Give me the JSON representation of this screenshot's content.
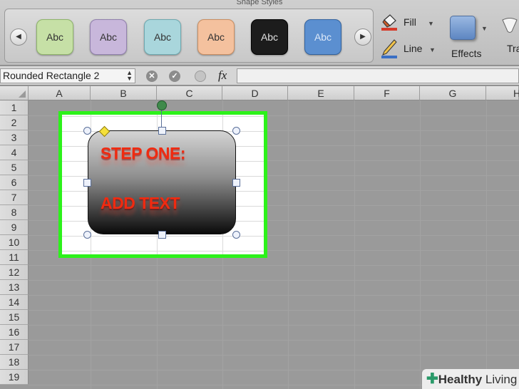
{
  "ribbon": {
    "group_title": "Shape Styles",
    "styles": [
      {
        "label": "Abc",
        "fill": "#c6e0a6",
        "border": "#8fb56a"
      },
      {
        "label": "Abc",
        "fill": "#c8b7db",
        "border": "#9180ad"
      },
      {
        "label": "Abc",
        "fill": "#a9d6dc",
        "border": "#6ea9b0"
      },
      {
        "label": "Abc",
        "fill": "#f4c19e",
        "border": "#c98e62"
      },
      {
        "label": "Abc",
        "fill": "#1c1c1c",
        "border": "#000000",
        "text_color": "#e0e0e0"
      },
      {
        "label": "Abc",
        "fill": "#5b8fd0",
        "border": "#33639f",
        "text_color": "#dce8f8"
      }
    ],
    "fill_label": "Fill",
    "line_label": "Line",
    "effects_label": "Effects",
    "next_group_partial": "Tra"
  },
  "formula_bar": {
    "name_box": "Rounded Rectangle 2",
    "fx": "fx",
    "cancel_glyph": "✕",
    "enter_glyph": "✓"
  },
  "sheet": {
    "columns": [
      "A",
      "B",
      "C",
      "D",
      "E",
      "F",
      "G",
      "H"
    ],
    "rows": [
      "1",
      "2",
      "3",
      "4",
      "5",
      "6",
      "7",
      "8",
      "9",
      "10",
      "11",
      "12",
      "13",
      "14",
      "15",
      "16",
      "17",
      "18",
      "19"
    ]
  },
  "shape": {
    "line1": "STEP ONE:",
    "line2": "ADD TEXT",
    "text_color": "#f02a10"
  },
  "highlight_color": "#2cf21a",
  "watermark": {
    "plus": "✚",
    "brand": "Healthy",
    "suffix": " Living"
  }
}
